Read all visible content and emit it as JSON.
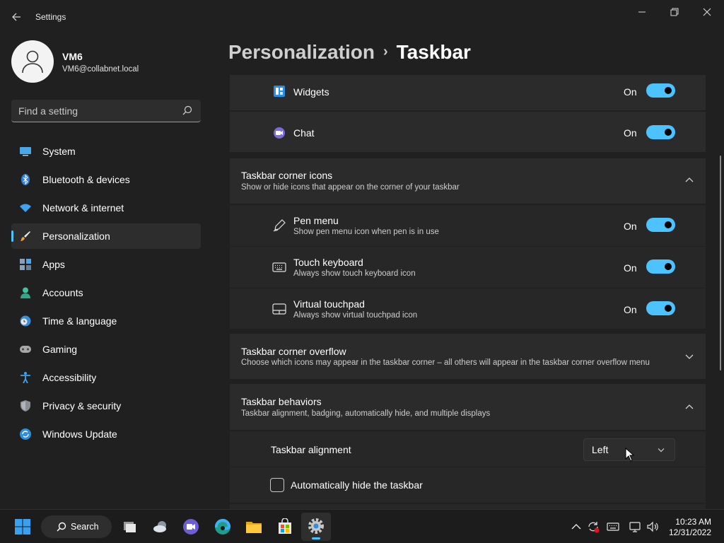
{
  "window": {
    "title": "Settings"
  },
  "profile": {
    "name": "VM6",
    "email": "VM6@collabnet.local"
  },
  "search": {
    "placeholder": "Find a setting"
  },
  "nav": {
    "items": [
      {
        "label": "System",
        "icon": "system-icon"
      },
      {
        "label": "Bluetooth & devices",
        "icon": "bluetooth-icon"
      },
      {
        "label": "Network & internet",
        "icon": "wifi-icon"
      },
      {
        "label": "Personalization",
        "icon": "brush-icon",
        "selected": true
      },
      {
        "label": "Apps",
        "icon": "apps-icon"
      },
      {
        "label": "Accounts",
        "icon": "accounts-icon"
      },
      {
        "label": "Time & language",
        "icon": "clock-globe-icon"
      },
      {
        "label": "Gaming",
        "icon": "gamepad-icon"
      },
      {
        "label": "Accessibility",
        "icon": "accessibility-icon"
      },
      {
        "label": "Privacy & security",
        "icon": "shield-icon"
      },
      {
        "label": "Windows Update",
        "icon": "update-icon"
      }
    ]
  },
  "breadcrumb": {
    "parent": "Personalization",
    "separator": "›",
    "current": "Taskbar"
  },
  "taskbar_items": {
    "widgets": {
      "title": "Widgets",
      "state": "On",
      "on": true
    },
    "chat": {
      "title": "Chat",
      "state": "On",
      "on": true
    }
  },
  "corner_icons": {
    "title": "Taskbar corner icons",
    "description": "Show or hide icons that appear on the corner of your taskbar",
    "expanded": true,
    "pen_menu": {
      "title": "Pen menu",
      "description": "Show pen menu icon when pen is in use",
      "state": "On",
      "on": true
    },
    "touch_keyboard": {
      "title": "Touch keyboard",
      "description": "Always show touch keyboard icon",
      "state": "On",
      "on": true
    },
    "virtual_touchpad": {
      "title": "Virtual touchpad",
      "description": "Always show virtual touchpad icon",
      "state": "On",
      "on": true
    }
  },
  "corner_overflow": {
    "title": "Taskbar corner overflow",
    "description": "Choose which icons may appear in the taskbar corner – all others will appear in the taskbar corner overflow menu",
    "expanded": false
  },
  "behaviors": {
    "title": "Taskbar behaviors",
    "description": "Taskbar alignment, badging, automatically hide, and multiple displays",
    "expanded": true,
    "alignment": {
      "label": "Taskbar alignment",
      "value": "Left"
    },
    "auto_hide": {
      "label": "Automatically hide the taskbar",
      "checked": false
    }
  },
  "taskbar": {
    "search_label": "Search",
    "apps": [
      "start-icon",
      "task-view-icon",
      "weather-icon",
      "teams-chat-icon",
      "edge-icon",
      "file-explorer-icon",
      "store-icon",
      "settings-icon"
    ],
    "active_app": "settings-icon",
    "time": "10:23 AM",
    "date": "12/31/2022"
  },
  "colors": {
    "accent": "#4cc2ff",
    "background": "#202020",
    "card": "#2b2b2b"
  }
}
